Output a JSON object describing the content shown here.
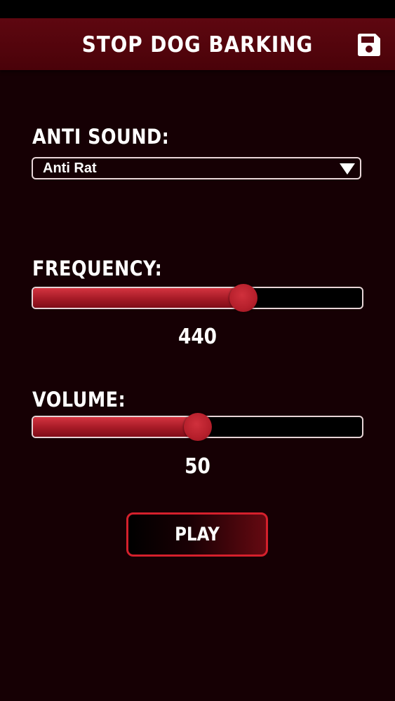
{
  "header": {
    "title": "STOP DOG BARKING",
    "save_icon": "floppy-disk-icon"
  },
  "anti_sound": {
    "label": "ANTI SOUND:",
    "selected": "Anti Rat",
    "arrow_icon": "triangle-down-icon"
  },
  "frequency": {
    "label": "FREQUENCY:",
    "value": "440",
    "level_fraction": 0.64
  },
  "volume": {
    "label": "VOLUME:",
    "value": "50",
    "level_fraction": 0.5
  },
  "play": {
    "label": "PLAY"
  },
  "colors": {
    "background": "#160004",
    "header": "#560510",
    "accent": "#b51f2b",
    "button_border": "#d4202c"
  }
}
